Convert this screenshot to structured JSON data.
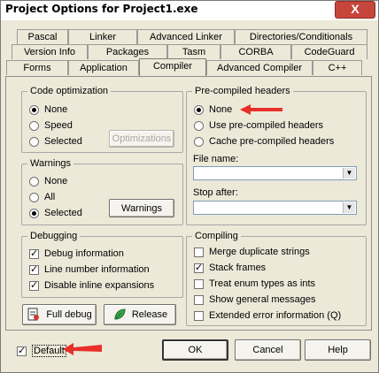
{
  "window": {
    "title": "Project Options for Project1.exe",
    "close_glyph": "X"
  },
  "tabs": {
    "row1": [
      "Pascal",
      "Linker",
      "Advanced Linker",
      "Directories/Conditionals"
    ],
    "row2": [
      "Version Info",
      "Packages",
      "Tasm",
      "CORBA",
      "CodeGuard"
    ],
    "row3": [
      "Forms",
      "Application",
      "Compiler",
      "Advanced Compiler",
      "C++"
    ],
    "active": "Compiler"
  },
  "code_optimization": {
    "title": "Code optimization",
    "options": [
      "None",
      "Speed",
      "Selected"
    ],
    "selected": "None",
    "button": "Optimizations"
  },
  "warnings": {
    "title": "Warnings",
    "options": [
      "None",
      "All",
      "Selected"
    ],
    "selected": "Selected",
    "button": "Warnings"
  },
  "debugging": {
    "title": "Debugging",
    "items": [
      {
        "label": "Debug information",
        "checked": true
      },
      {
        "label": "Line number information",
        "checked": true
      },
      {
        "label": "Disable inline expansions",
        "checked": true
      }
    ]
  },
  "precompiled": {
    "title": "Pre-compiled headers",
    "options": [
      "None",
      "Use pre-compiled headers",
      "Cache pre-compiled headers"
    ],
    "selected": "None",
    "file_name_label": "File name:",
    "file_name_value": "",
    "stop_after_label": "Stop after:",
    "stop_after_value": ""
  },
  "compiling": {
    "title": "Compiling",
    "items": [
      {
        "label": "Merge duplicate strings",
        "checked": false
      },
      {
        "label": "Stack frames",
        "checked": true
      },
      {
        "label": "Treat enum types as ints",
        "checked": false
      },
      {
        "label": "Show general messages",
        "checked": false
      },
      {
        "label": "Extended error information (Q)",
        "checked": false
      }
    ]
  },
  "actions": {
    "full_debug": "Full debug",
    "release": "Release"
  },
  "footer": {
    "default_label": "Default",
    "default_checked": true,
    "ok": "OK",
    "cancel": "Cancel",
    "help": "Help"
  },
  "colors": {
    "annotation_arrow": "#e8302a",
    "dialog_bg": "#ece9d8",
    "close_button": "#c7463b"
  }
}
